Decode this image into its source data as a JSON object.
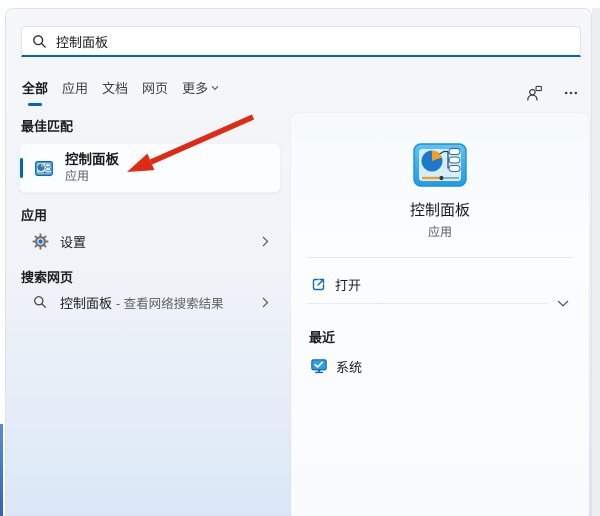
{
  "colors": {
    "accent": "#0067c0",
    "annotation_arrow": "#df2b16",
    "action_icon_blue": "#0f6cbd"
  },
  "search_box": {
    "value": "控制面板",
    "icon": "search-icon"
  },
  "filter_tabs": {
    "items": [
      {
        "label": "全部",
        "active": true
      },
      {
        "label": "应用",
        "active": false
      },
      {
        "label": "文档",
        "active": false
      },
      {
        "label": "网页",
        "active": false
      },
      {
        "label": "更多",
        "active": false,
        "has_dropdown": true
      }
    ]
  },
  "top_icons": [
    {
      "name": "account-icon"
    },
    {
      "name": "ellipsis-icon"
    }
  ],
  "left_panel": {
    "best_match_header": "最佳匹配",
    "best_match": {
      "title": "控制面板",
      "subtitle": "应用",
      "icon": "control-panel-icon"
    },
    "apps_header": "应用",
    "apps_items": [
      {
        "label": "设置",
        "icon": "gear-icon"
      }
    ],
    "web_header": "搜索网页",
    "web_items": [
      {
        "query": "控制面板",
        "suffix": "- 查看网络搜索结果",
        "icon": "search-icon"
      }
    ]
  },
  "right_panel": {
    "app_title": "控制面板",
    "app_subtitle": "应用",
    "app_icon": "control-panel-icon",
    "actions": [
      {
        "label": "打开",
        "icon": "open-external-icon"
      }
    ],
    "recent_header": "最近",
    "recent_items": [
      {
        "label": "系统",
        "icon": "system-monitor-icon"
      }
    ]
  }
}
